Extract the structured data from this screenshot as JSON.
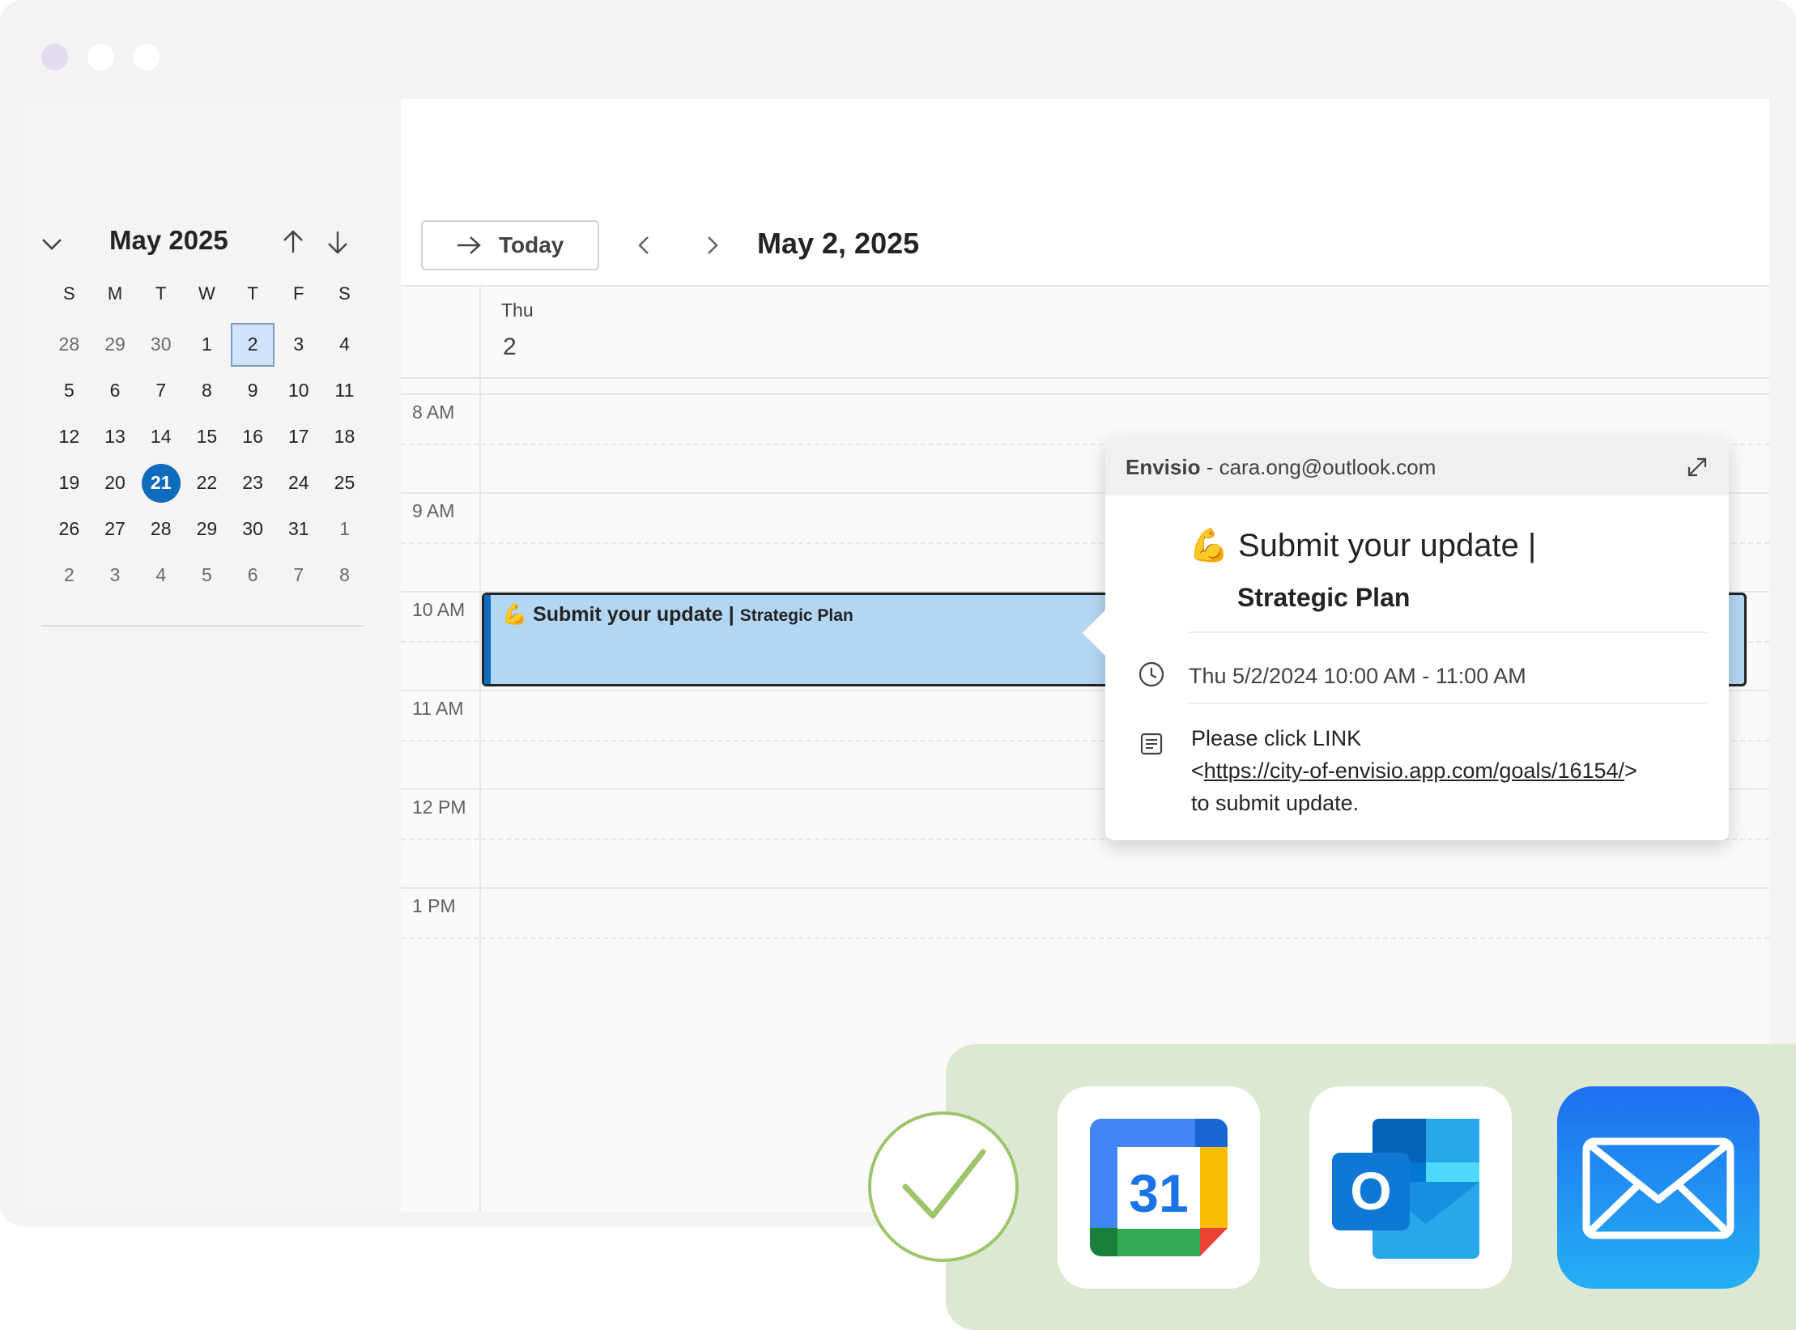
{
  "sidebar": {
    "month_title": "May 2025",
    "weekday_headers": [
      "S",
      "M",
      "T",
      "W",
      "T",
      "F",
      "S"
    ],
    "weeks": [
      [
        "28",
        "29",
        "30",
        "1",
        "2",
        "3",
        "4"
      ],
      [
        "5",
        "6",
        "7",
        "8",
        "9",
        "10",
        "11"
      ],
      [
        "12",
        "13",
        "14",
        "15",
        "16",
        "17",
        "18"
      ],
      [
        "19",
        "20",
        "21",
        "22",
        "23",
        "24",
        "25"
      ],
      [
        "26",
        "27",
        "28",
        "29",
        "30",
        "31",
        "1"
      ],
      [
        "2",
        "3",
        "4",
        "5",
        "6",
        "7",
        "8"
      ]
    ],
    "selected_day": "2",
    "today_day": "21"
  },
  "toolbar": {
    "today_label": "Today",
    "date_title": "May 2, 2025"
  },
  "day_view": {
    "weekday": "Thu",
    "day_number": "2",
    "hours": [
      "8 AM",
      "9 AM",
      "10 AM",
      "11 AM",
      "12 PM",
      "1 PM"
    ]
  },
  "event": {
    "emoji": "💪",
    "title": "Submit your update |",
    "subtitle": "Strategic Plan"
  },
  "popup": {
    "organizer": "Envisio",
    "separator": " - ",
    "email": "cara.ong@outlook.com",
    "title": "Submit your update |",
    "subtitle": "Strategic Plan",
    "time": "Thu 5/2/2024 10:00 AM - 11:00 AM",
    "notes_line1": "Please click LINK",
    "link": "https://city-of-envisio.app.com/goals/16154/",
    "notes_line3": "to submit update."
  },
  "integrations": {
    "gcal_number": "31",
    "outlook_letter": "O"
  },
  "colors": {
    "accent": "#0f6cbd",
    "event_fill": "#b3d6f2",
    "panel": "#dde8d3",
    "check": "#9dc56a"
  }
}
